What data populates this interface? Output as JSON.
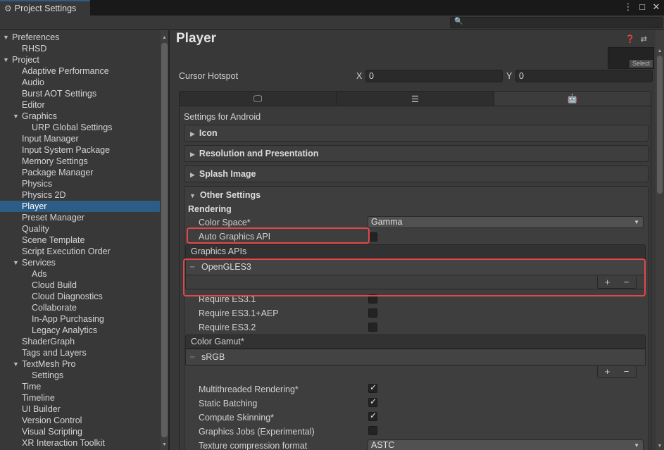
{
  "window": {
    "tab_title": "Project Settings",
    "controls": [
      "⋮",
      "□",
      "✕"
    ]
  },
  "search": {
    "placeholder": ""
  },
  "sidebar": {
    "items": [
      {
        "label": "Preferences",
        "level": 0,
        "expandable": true
      },
      {
        "label": "RHSD",
        "level": 1
      },
      {
        "label": "Project",
        "level": 0,
        "expandable": true
      },
      {
        "label": "Adaptive Performance",
        "level": 1
      },
      {
        "label": "Audio",
        "level": 1
      },
      {
        "label": "Burst AOT Settings",
        "level": 1
      },
      {
        "label": "Editor",
        "level": 1
      },
      {
        "label": "Graphics",
        "level": 1,
        "expandable": true
      },
      {
        "label": "URP Global Settings",
        "level": 2
      },
      {
        "label": "Input Manager",
        "level": 1
      },
      {
        "label": "Input System Package",
        "level": 1
      },
      {
        "label": "Memory Settings",
        "level": 1
      },
      {
        "label": "Package Manager",
        "level": 1
      },
      {
        "label": "Physics",
        "level": 1
      },
      {
        "label": "Physics 2D",
        "level": 1
      },
      {
        "label": "Player",
        "level": 1,
        "selected": true
      },
      {
        "label": "Preset Manager",
        "level": 1
      },
      {
        "label": "Quality",
        "level": 1
      },
      {
        "label": "Scene Template",
        "level": 1
      },
      {
        "label": "Script Execution Order",
        "level": 1
      },
      {
        "label": "Services",
        "level": 1,
        "expandable": true
      },
      {
        "label": "Ads",
        "level": 2
      },
      {
        "label": "Cloud Build",
        "level": 2
      },
      {
        "label": "Cloud Diagnostics",
        "level": 2
      },
      {
        "label": "Collaborate",
        "level": 2
      },
      {
        "label": "In-App Purchasing",
        "level": 2
      },
      {
        "label": "Legacy Analytics",
        "level": 2
      },
      {
        "label": "ShaderGraph",
        "level": 1
      },
      {
        "label": "Tags and Layers",
        "level": 1
      },
      {
        "label": "TextMesh Pro",
        "level": 1,
        "expandable": true
      },
      {
        "label": "Settings",
        "level": 2
      },
      {
        "label": "Time",
        "level": 1
      },
      {
        "label": "Timeline",
        "level": 1
      },
      {
        "label": "UI Builder",
        "level": 1
      },
      {
        "label": "Version Control",
        "level": 1
      },
      {
        "label": "Visual Scripting",
        "level": 1
      },
      {
        "label": "XR Interaction Toolkit",
        "level": 1
      }
    ]
  },
  "main": {
    "title": "Player",
    "preview_select": "Select",
    "cursor_hotspot": {
      "label": "Cursor Hotspot",
      "x_label": "X",
      "x_value": "0",
      "y_label": "Y",
      "y_value": "0"
    },
    "platform_tabs": [
      "monitor-icon",
      "server-icon",
      "android-icon"
    ],
    "settings_for": "Settings for Android",
    "foldouts": [
      "Icon",
      "Resolution and Presentation",
      "Splash Image"
    ],
    "other_settings": {
      "title": "Other Settings",
      "rendering_label": "Rendering",
      "color_space_label": "Color Space*",
      "color_space_value": "Gamma",
      "auto_graphics_label": "Auto Graphics API",
      "auto_graphics_checked": false,
      "graphics_apis_label": "Graphics APIs",
      "graphics_apis_items": [
        "OpenGLES3"
      ],
      "require_items": [
        {
          "label": "Require ES3.1",
          "checked": false
        },
        {
          "label": "Require ES3.1+AEP",
          "checked": false
        },
        {
          "label": "Require ES3.2",
          "checked": false
        }
      ],
      "color_gamut_label": "Color Gamut*",
      "color_gamut_items": [
        "sRGB"
      ],
      "options": [
        {
          "label": "Multithreaded Rendering*",
          "checked": true
        },
        {
          "label": "Static Batching",
          "checked": true
        },
        {
          "label": "Compute Skinning*",
          "checked": true
        },
        {
          "label": "Graphics Jobs (Experimental)",
          "checked": false
        }
      ],
      "texture_compression_label": "Texture compression format",
      "texture_compression_value": "ASTC"
    }
  },
  "colors": {
    "highlight": "#e0474b",
    "selection": "#2c5d87"
  }
}
